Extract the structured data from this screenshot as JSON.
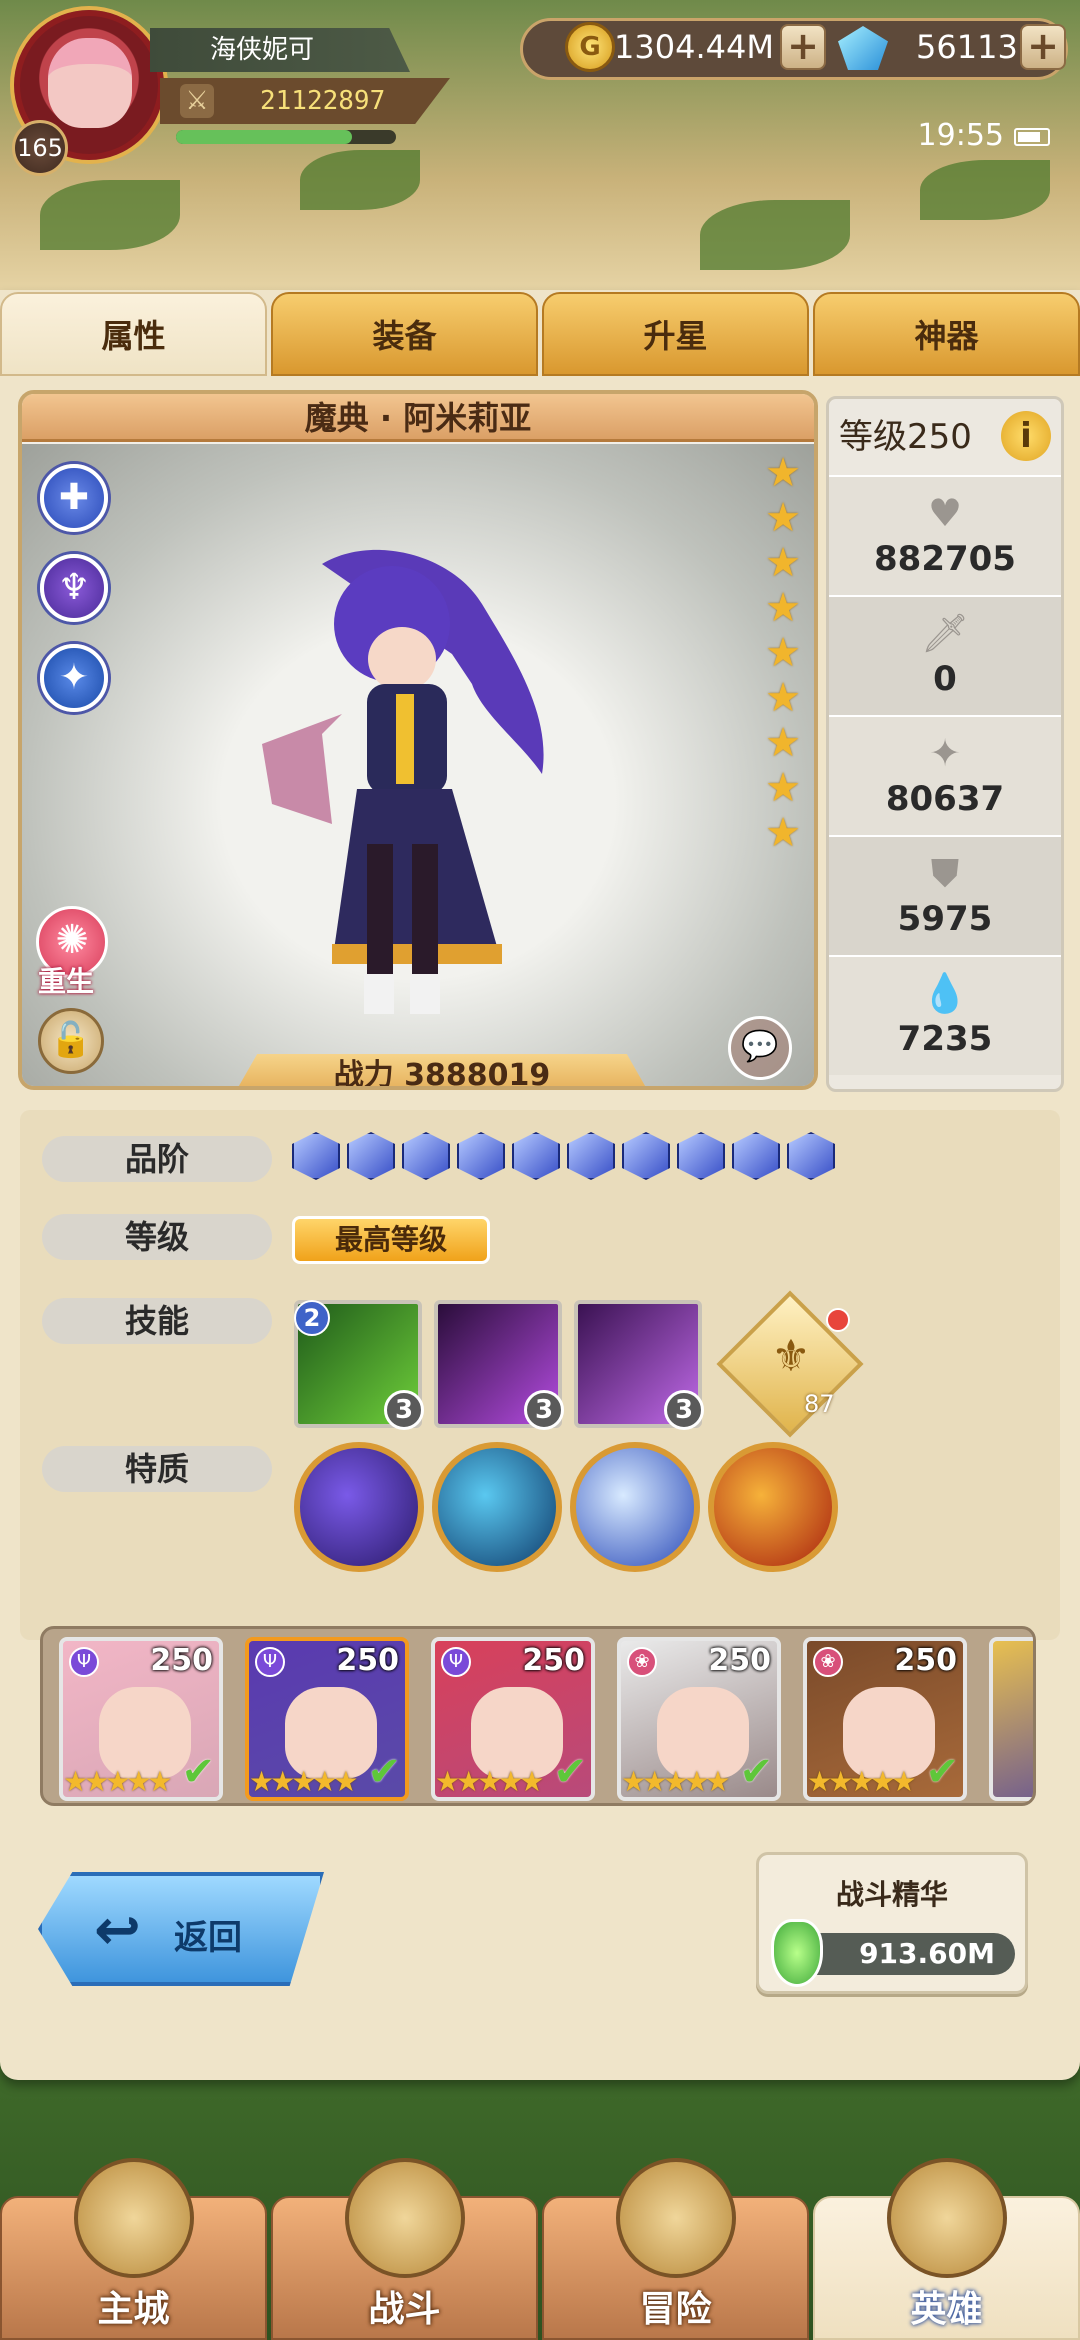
{
  "player": {
    "name": "海侠妮可",
    "level": "165",
    "power": "21122897",
    "exp_fraction": 0.8
  },
  "currency": {
    "gold": "1304.44M",
    "gems": "56113"
  },
  "status": {
    "time": "19:55"
  },
  "tabs": [
    {
      "label": "属性",
      "active": true
    },
    {
      "label": "装备",
      "active": false
    },
    {
      "label": "升星",
      "active": false
    },
    {
      "label": "神器",
      "active": false
    }
  ],
  "hero": {
    "name": "魔典 · 阿米莉亚",
    "power_label": "战力 3888019",
    "stars": 9,
    "rebirth_label": "重生",
    "side_icons": [
      "cross-icon",
      "class-icon",
      "faction-icon"
    ]
  },
  "stats": {
    "level_label": "等级250",
    "info_symbol": "i",
    "rows": [
      {
        "icon": "heart-icon",
        "value": "882705"
      },
      {
        "icon": "sword-icon",
        "value": "0"
      },
      {
        "icon": "shuriken-icon",
        "value": "80637"
      },
      {
        "icon": "shield-icon",
        "value": "5975"
      },
      {
        "icon": "drop-icon",
        "value": "7235"
      }
    ]
  },
  "details": {
    "rank_label": "品阶",
    "rank_gems": 10,
    "level_label": "等级",
    "level_value": "最高等级",
    "skills_label": "技能",
    "skills": [
      {
        "level": "3",
        "badge": "2",
        "colors": [
          "#1f5a1a",
          "#6fcf3a"
        ]
      },
      {
        "level": "3",
        "badge": "",
        "colors": [
          "#2a0d3a",
          "#b44ce0"
        ]
      },
      {
        "level": "3",
        "badge": "",
        "colors": [
          "#3a1252",
          "#c06ae8"
        ]
      }
    ],
    "emblem_count": "87",
    "traits_label": "特质",
    "traits": [
      {
        "colors": [
          "#2a1a6a",
          "#7a5ae8"
        ]
      },
      {
        "colors": [
          "#0e3a6a",
          "#5ac8f0"
        ]
      },
      {
        "colors": [
          "#2a4ab8",
          "#d8eaff"
        ]
      },
      {
        "colors": [
          "#a8200e",
          "#f6b23a"
        ]
      }
    ]
  },
  "roster": [
    {
      "level": "250",
      "class": "mage",
      "selected": false,
      "bg": "#d9a7b6",
      "hair": "#f2b6c6"
    },
    {
      "level": "250",
      "class": "mage",
      "selected": true,
      "bg": "#5a4aa8",
      "hair": "#5a3ab0"
    },
    {
      "level": "250",
      "class": "mage",
      "selected": false,
      "bg": "#b84a7a",
      "hair": "#d8405a"
    },
    {
      "level": "250",
      "class": "healer",
      "selected": false,
      "bg": "#9a8a8a",
      "hair": "#eaeaea"
    },
    {
      "level": "250",
      "class": "healer",
      "selected": false,
      "bg": "#a86a3a",
      "hair": "#7a4a2a"
    }
  ],
  "back_label": "返回",
  "essence": {
    "title": "战斗精华",
    "value": "913.60M"
  },
  "nav": [
    {
      "label": "主城",
      "active": false
    },
    {
      "label": "战斗",
      "active": false
    },
    {
      "label": "冒险",
      "active": false
    },
    {
      "label": "英雄",
      "active": true
    }
  ]
}
